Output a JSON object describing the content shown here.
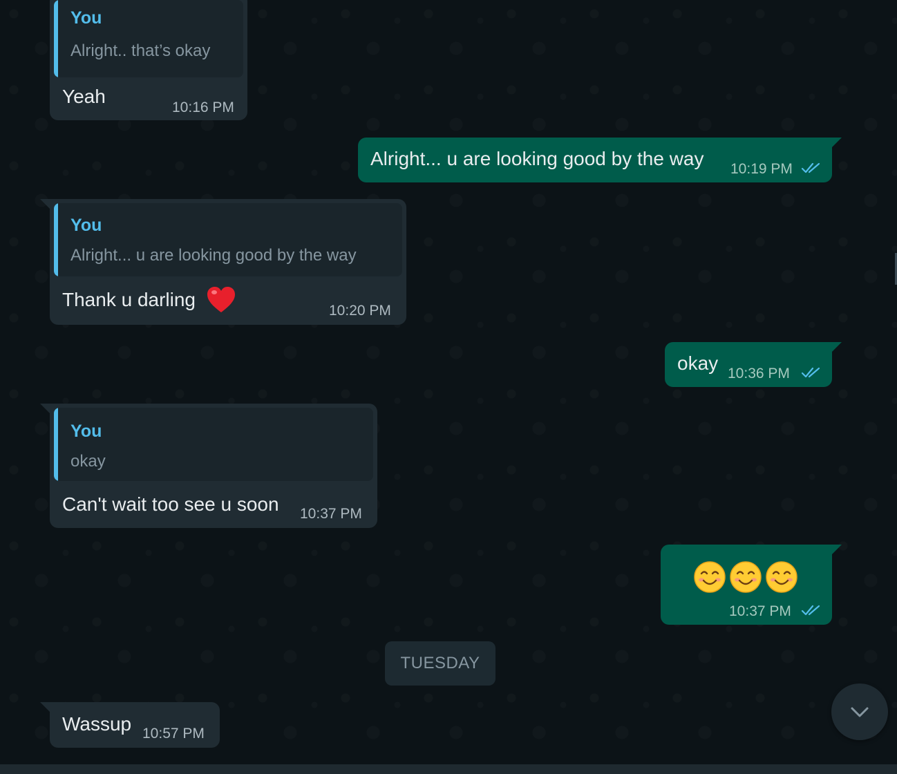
{
  "messages": [
    {
      "direction": "in",
      "quote_author": "You",
      "quote_text": "Alright.. that’s okay",
      "text": "Yeah",
      "time": "10:16 PM"
    },
    {
      "direction": "out",
      "text": "Alright... u are looking good by the way",
      "time": "10:19 PM",
      "status": "read"
    },
    {
      "direction": "in",
      "quote_author": "You",
      "quote_text": "Alright... u are looking good by the way",
      "text": "Thank u darling",
      "emoji": "red-heart",
      "time": "10:20 PM"
    },
    {
      "direction": "out",
      "text": "okay",
      "time": "10:36 PM",
      "status": "read"
    },
    {
      "direction": "in",
      "quote_author": "You",
      "quote_text": "okay",
      "text": "Can't wait too see u soon",
      "time": "10:37 PM"
    },
    {
      "direction": "out",
      "emoji": "smiling-face-with-smiling-eyes ×3",
      "time": "10:37 PM",
      "status": "read"
    },
    {
      "direction": "in",
      "text": "Wassup",
      "time": "10:57 PM"
    }
  ],
  "date_separator": "TUESDAY",
  "icons": {
    "read_ticks": "double-check-icon",
    "scroll_down": "chevron-down-icon"
  },
  "colors": {
    "background": "#0c1317",
    "incoming_bubble": "#202c33",
    "outgoing_bubble": "#005c4b",
    "quote_accent": "#53bdeb",
    "read_ticks": "#53bdeb"
  }
}
